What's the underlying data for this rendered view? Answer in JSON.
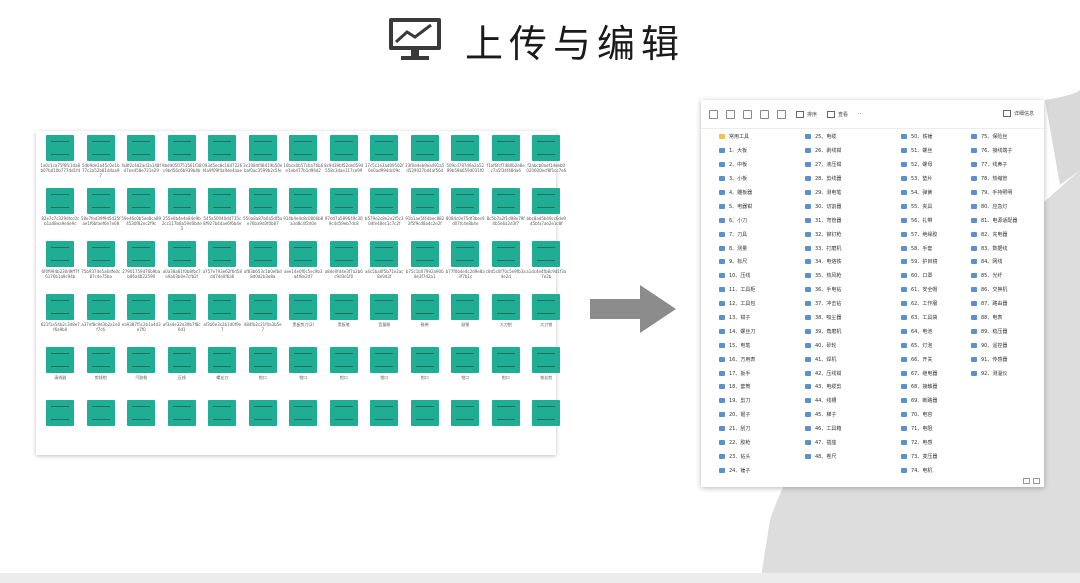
{
  "page_title": "上传与编辑",
  "header_icon": "monitor-chart-icon",
  "arrow_icon": "right-arrow-icon",
  "colors": {
    "thumb": "#1fae93",
    "arrow": "#8c8c8c",
    "accent_shape": "#d9d9d9",
    "folder": "#f0c14b",
    "file": "#5a8fd0"
  },
  "grid": {
    "filenames": [
      "1a0c1ca75f6fc1da8b07bd10b777dd1fd",
      "5db9de1a45c0e1b77c2a52b81d4aa97",
      "fa8f2c4d2ad3a148fd7ee458e721e29",
      "9bdd050751561f38c9bd56c6b939b4b",
      "093d5ec8c1847226f4a9f09f4a9de4aae",
      "3c1084f48419b50ebaf0ac3599b2c5fe",
      "10bca0b57cba76b6e1eb477b1d96d2",
      "8c9d39bf52de0594558c3dae117ce99",
      "17c5c1e3ad09502f6e0ad994dc09c",
      "23f0edeb9ea491a5d529027b44af56d",
      "509cd787d6a2a5299b59b659d031f0",
      "f1af6fcf7480b2e8ec7a5f34f48da6",
      "f2abcb0aef1deeb0020600ecf8f1cc7e6",
      "82e7c7c329dfcc0cb1a48ea9e4e9c",
      "58e7fed39f9d5d25fae1f6bfaef6e7e08",
      "59e46c0b5ee8ca894530f82ec2f9c",
      "255e0b4e4e84e9b2cc117b8a59d0bde3",
      "545a50040d4735c8f927b44ae6f6b4e",
      "550a8a87b0a5df5ae76ba9d3f0b87",
      "914b4e4c8c0806b8a3d8c4f2d0e",
      "97dd7a589649c309c4d59eb7dc8",
      "b579e2c8e2e2f5c30dfe48ec1c7c2f",
      "91b1ae5f44bec8823f5f9cd8a4c2e2f",
      "8084c0e75df3bec9d07fc4e8b4e",
      "8c5b7a2f1d98e79f4b5e6a2d3f7",
      "bbc8ad5b49cc6de9d5bfa7ae2e1c8f",
      "6f0f994b230d9ff7f6176b1a9c94b",
      "75b9374e5a6dfe0c87c4e75ba",
      "27901759d76b9bab86a4b22590",
      "a0a38a81f0b8fbc7e9a03b0e7cfb2f",
      "a757e793e62f6d58d474e0f6a6",
      "af83b653c1b0efbd8d0d2b3e8a",
      "aee14e0f0c5ec9b3a4f8e2d7",
      "a8de0fd4e3f7a2b6c9d3e1f0",
      "a4c5ba0f5b71e2ac8e9d3f",
      "b75c1b07992a90b8e3f7d2a1",
      "b77f0b4e4c2d9e8a3f7b1c",
      "c8d5c0f70c5e9fb3a4e2d",
      "a1dc4e4fb8c9d1f3a7e2b",
      "621f1a54b2c3d8e7f6a9b0",
      "a37ef8c9d3b2a1e0f7c6",
      "ea9387f5c2b1a4d3e7f0",
      "af3a4e32e39b7f8c0d1",
      "af3a6e3c2b1d0f9e7",
      "484fb2c21f0a3b5e7",
      "黑板剪刀(2)",
      "黑板笔",
      "音量刷",
      "鞋带",
      "鼓锤",
      "大刀钳",
      "大刀钳"
    ],
    "row5_labels": [
      "清线器",
      "剪线钳",
      "汽胶枪",
      "压线",
      "螺丝刀",
      "钳口",
      "钳口",
      "钳口",
      "钳口",
      "钳口",
      "钳口",
      "钳口",
      "铁丝剪"
    ],
    "row6_labels": [
      "",
      "",
      "",
      "",
      "",
      "",
      "",
      "",
      "",
      "",
      "",
      "",
      ""
    ]
  },
  "explorer": {
    "toolbar": {
      "sort": "排序",
      "view": "查看",
      "more": "···",
      "details": "详细信息"
    },
    "columns": [
      [
        "常用工具",
        "1、大板",
        "2、中板",
        "3、小板",
        "4、雕板器",
        "5、电器钳",
        "6、小刀",
        "7、刀具",
        "8、测量",
        "9、标尺",
        "10、压线",
        "11、工具柜",
        "12、工具包",
        "13、钳子",
        "14、螺丝刀",
        "15、电笔",
        "16、万用表",
        "17、扳手",
        "18、套筒",
        "19、剪刀",
        "20、锯子",
        "21、刮刀",
        "22、胶枪",
        "23、钻头",
        "24、锤子"
      ],
      [
        "25、电缆",
        "26、剥线钳",
        "27、液压钳",
        "28、剪线器",
        "29、测电笔",
        "30、切割器",
        "31、弯管器",
        "32、铆钉枪",
        "33、打磨机",
        "34、电烙铁",
        "35、热风枪",
        "36、手电钻",
        "37、冲击钻",
        "38、吸尘器",
        "39、角磨机",
        "40、砂轮",
        "41、焊机",
        "42、压线钳",
        "43、电缆剪",
        "44、线槽",
        "45、梯子",
        "46、工具箱",
        "47、插座",
        "48、卷尺"
      ],
      [
        "50、铁锤",
        "51、螺丝",
        "52、螺母",
        "53、垫片",
        "54、弹簧",
        "55、夹具",
        "56、扎带",
        "57、绝缘胶",
        "58、手套",
        "59、护目镜",
        "60、口罩",
        "61、安全帽",
        "62、工作服",
        "63、工具袋",
        "64、电池",
        "65、灯泡",
        "66、开关",
        "67、继电器",
        "68、接触器",
        "69、断路器",
        "70、电容",
        "71、电阻",
        "72、电感",
        "73、变压器",
        "74、电机"
      ],
      [
        "75、保险丝",
        "76、接线端子",
        "77、线鼻子",
        "78、热缩管",
        "79、手持照明",
        "80、应急灯",
        "81、电源适配器",
        "82、充电器",
        "83、数据线",
        "84、网线",
        "85、光纤",
        "86、交换机",
        "87、路由器",
        "88、电表",
        "89、稳压器",
        "90、遥控器",
        "91、传感器",
        "92、测温仪"
      ]
    ]
  }
}
